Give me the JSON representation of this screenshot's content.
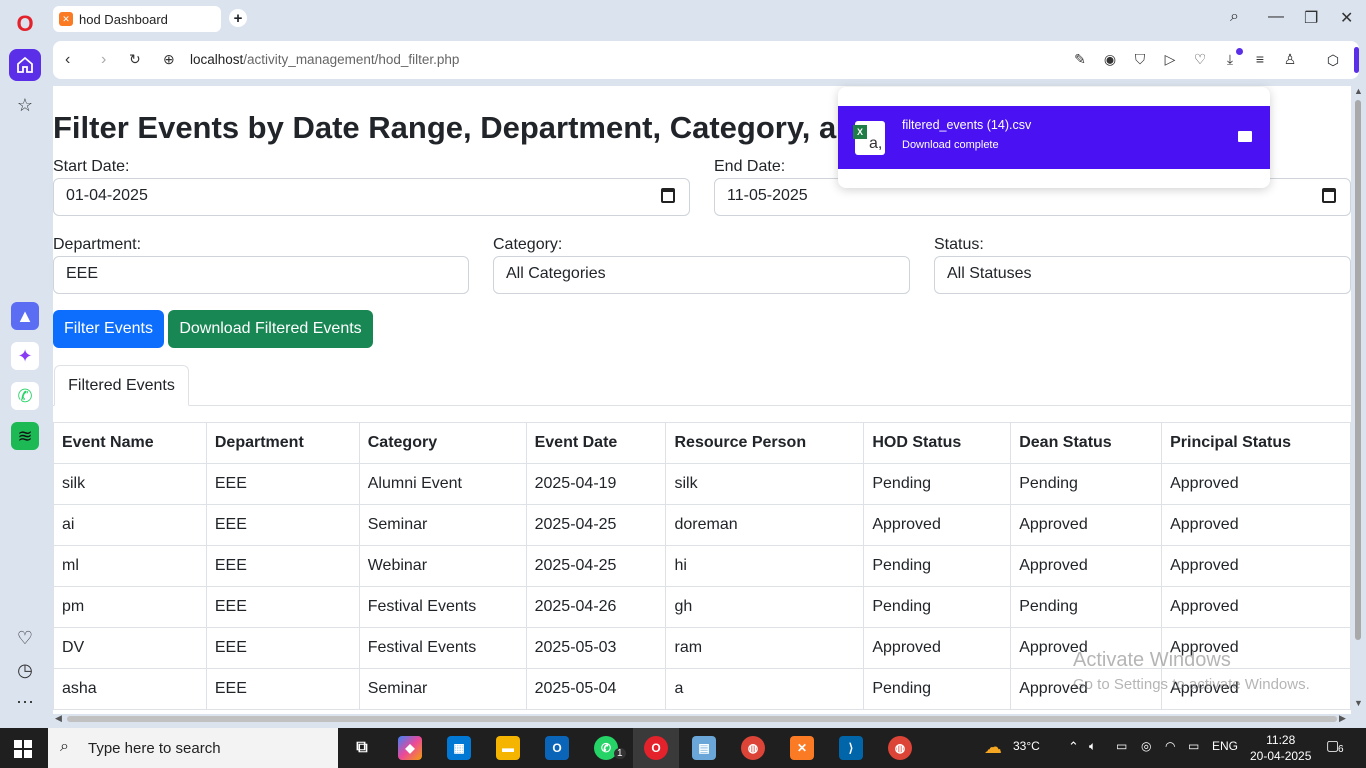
{
  "browser": {
    "tab_title": "hod Dashboard",
    "new_tab": "+",
    "url_host": "localhost",
    "url_path": "/activity_management/hod_filter.php"
  },
  "page": {
    "title": "Filter Events by Date Range, Department, Category, an",
    "start_date_label": "Start Date:",
    "start_date_value": "01-04-2025",
    "end_date_label": "End Date:",
    "end_date_value": "11-05-2025",
    "department_label": "Department:",
    "department_value": "EEE",
    "category_label": "Category:",
    "category_value": "All Categories",
    "status_label": "Status:",
    "status_value": "All Statuses",
    "filter_button": "Filter Events",
    "download_button": "Download Filtered Events",
    "tab_label": "Filtered Events"
  },
  "table": {
    "headers": [
      "Event Name",
      "Department",
      "Category",
      "Event Date",
      "Resource Person",
      "HOD Status",
      "Dean Status",
      "Principal Status"
    ],
    "rows": [
      [
        "silk",
        "EEE",
        "Alumni Event",
        "2025-04-19",
        "silk",
        "Pending",
        "Pending",
        "Approved"
      ],
      [
        "ai",
        "EEE",
        "Seminar",
        "2025-04-25",
        "doreman",
        "Approved",
        "Approved",
        "Approved"
      ],
      [
        "ml",
        "EEE",
        "Webinar",
        "2025-04-25",
        "hi",
        "Pending",
        "Approved",
        "Approved"
      ],
      [
        "pm",
        "EEE",
        "Festival Events",
        "2025-04-26",
        "gh",
        "Pending",
        "Pending",
        "Approved"
      ],
      [
        "DV",
        "EEE",
        "Festival Events",
        "2025-05-03",
        "ram",
        "Approved",
        "Approved",
        "Approved"
      ],
      [
        "asha",
        "EEE",
        "Seminar",
        "2025-05-04",
        "a",
        "Pending",
        "Approved",
        "Approved"
      ]
    ]
  },
  "download_popup": {
    "file_name": "filtered_events (14).csv",
    "status": "Download complete"
  },
  "watermark": {
    "line1": "Activate Windows",
    "line2": "Go to Settings to activate Windows."
  },
  "taskbar": {
    "search_placeholder": "Type here to search",
    "weather": "33°C",
    "language": "ENG",
    "time": "11:28",
    "date": "20-04-2025",
    "notifications": "6",
    "whatsapp_badge": "1"
  },
  "colors": {
    "accent": "#5b2ee8",
    "primary_button": "#0d6efd",
    "success_button": "#198754",
    "download_item": "#4a12f2"
  }
}
